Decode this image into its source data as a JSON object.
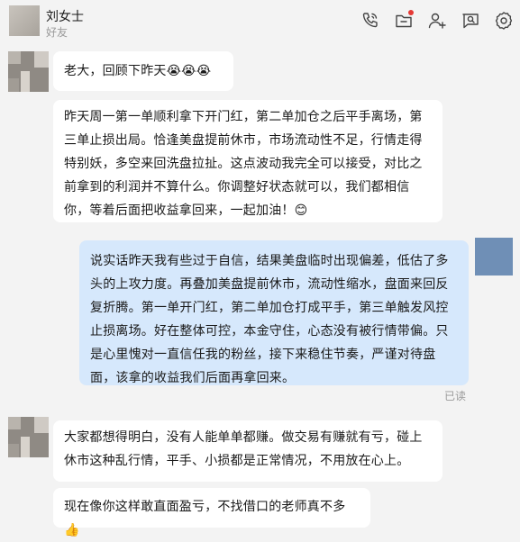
{
  "header": {
    "contact_name": "刘女士",
    "contact_subtitle": "好友",
    "tools": [
      "phone-call-icon",
      "folder-icon",
      "add-friend-icon",
      "chat-search-icon",
      "settings-icon"
    ]
  },
  "colors": {
    "background": "#f3f3f3",
    "bubble_left": "#ffffff",
    "bubble_right": "#d6e8fc",
    "notification_dot": "#e53935"
  },
  "messages": [
    {
      "side": "left",
      "text": "老大，回顾下昨天😭😭😭"
    },
    {
      "side": "left",
      "text": "昨天周一第一单顺利拿下开门红，第二单加仓之后平手离场，第三单止损出局。恰逢美盘提前休市，市场流动性不足，行情走得特别妖，多空来回洗盘拉扯。这点波动我完全可以接受，对比之前拿到的利润并不算什么。你调整好状态就可以，我们都相信你，等着后面把收益拿回来，一起加油！😊"
    },
    {
      "side": "right",
      "text": "说实话昨天我有些过于自信，结果美盘临时出现偏差，低估了多头的上攻力度。再叠加美盘提前休市，流动性缩水，盘面来回反复折腾。第一单开门红，第二单加仓打成平手，第三单触发风控止损离场。好在整体可控，本金守住，心态没有被行情带偏。只是心里愧对一直信任我的粉丝，接下来稳住节奏，严谨对待盘面，该拿的收益我们后面再拿回来。",
      "status": "已读"
    },
    {
      "side": "left",
      "text": "大家都想得明白，没有人能单单都赚。做交易有赚就有亏，碰上休市这种乱行情，平手、小损都是正常情况，不用放在心上。"
    },
    {
      "side": "left",
      "text": "现在像你这样敢直面盈亏，不找借口的老师真不多👍"
    }
  ]
}
